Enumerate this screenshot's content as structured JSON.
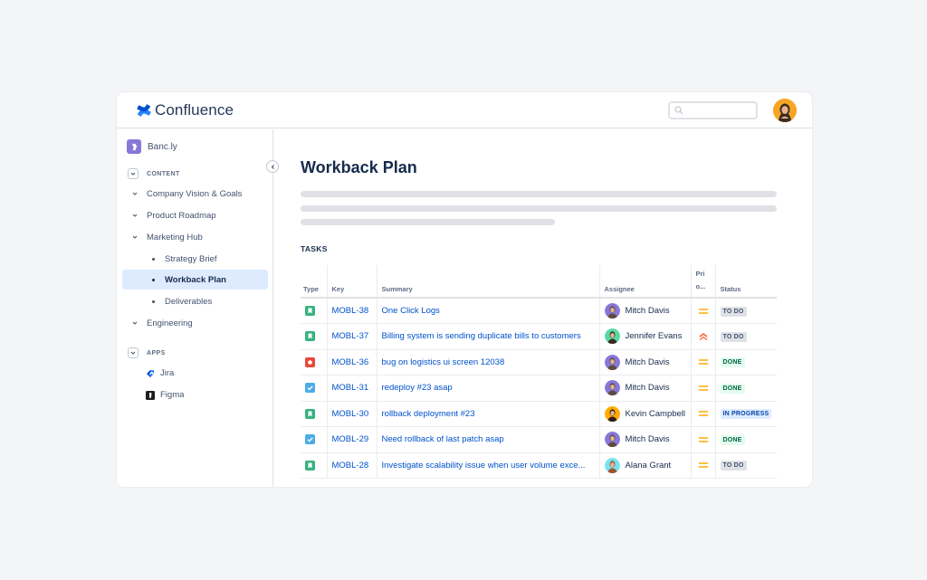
{
  "app": {
    "name": "Confluence"
  },
  "search": {
    "placeholder": ""
  },
  "sidebar": {
    "space_name": "Banc.ly",
    "content_label": "CONTENT",
    "items": [
      {
        "label": "Company Vision & Goals"
      },
      {
        "label": "Product Roadmap"
      },
      {
        "label": "Marketing Hub"
      },
      {
        "label": "Strategy Brief"
      },
      {
        "label": "Workback Plan"
      },
      {
        "label": "Deliverables"
      },
      {
        "label": "Engineering"
      }
    ],
    "apps_label": "APPS",
    "apps": [
      {
        "label": "Jira",
        "icon": "jira-icon"
      },
      {
        "label": "Figma",
        "icon": "figma-icon"
      }
    ]
  },
  "page": {
    "title": "Workback Plan",
    "tasks_label": "TASKS"
  },
  "table": {
    "headers": {
      "type": "Type",
      "key": "Key",
      "summary": "Summary",
      "assignee": "Assignee",
      "priority": "Pri\no...",
      "status": "Status"
    },
    "rows": [
      {
        "type": "story",
        "key": "MOBL-38",
        "summary": "One Click Logs",
        "assignee": "Mitch Davis",
        "priority": "medium",
        "status": "TO DO"
      },
      {
        "type": "story",
        "key": "MOBL-37",
        "summary": "Billing system is sending duplicate bills to customers",
        "assignee": "Jennifer Evans",
        "priority": "highest",
        "status": "TO DO"
      },
      {
        "type": "bug",
        "key": "MOBL-36",
        "summary": "bug on logistics ui screen 12038",
        "assignee": "Mitch Davis",
        "priority": "medium",
        "status": "DONE"
      },
      {
        "type": "task",
        "key": "MOBL-31",
        "summary": "redeploy #23 asap",
        "assignee": "Mitch Davis",
        "priority": "medium",
        "status": "DONE"
      },
      {
        "type": "story",
        "key": "MOBL-30",
        "summary": "rollback deployment #23",
        "assignee": "Kevin Campbell",
        "priority": "medium",
        "status": "IN PROGRESS"
      },
      {
        "type": "task",
        "key": "MOBL-29",
        "summary": "Need rollback of last patch asap",
        "assignee": "Mitch Davis",
        "priority": "medium",
        "status": "DONE"
      },
      {
        "type": "story",
        "key": "MOBL-28",
        "summary": "Investigate scalability issue when user volume exce...",
        "assignee": "Alana Grant",
        "priority": "medium",
        "status": "TO DO"
      }
    ]
  },
  "colors": {
    "brand": "#0052cc",
    "story": "#36b37e",
    "bug": "#e5493a",
    "task": "#4bade8",
    "priority_medium": "#ffab00",
    "priority_highest": "#ff5630"
  }
}
